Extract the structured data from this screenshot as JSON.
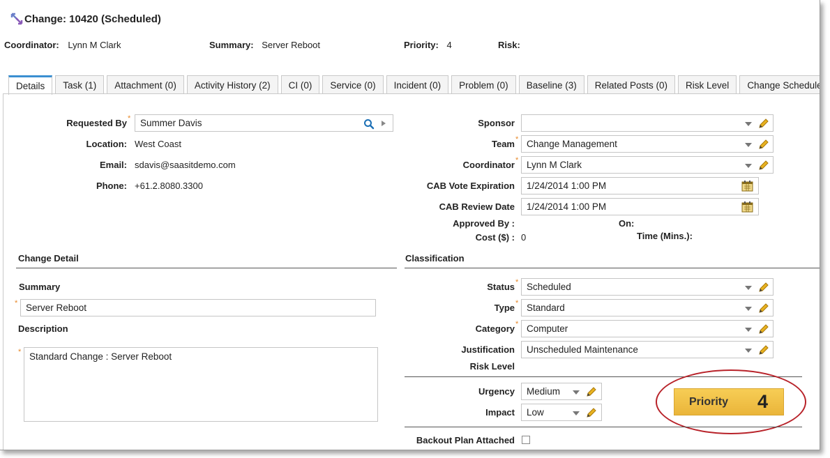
{
  "title": "Change: 10420 (Scheduled)",
  "header": {
    "coordinator_label": "Coordinator:",
    "coordinator_value": "Lynn M Clark",
    "summary_label": "Summary:",
    "summary_value": "Server Reboot",
    "priority_label": "Priority:",
    "priority_value": "4",
    "risk_label": "Risk:",
    "risk_value": ""
  },
  "tabs": [
    {
      "label": "Details"
    },
    {
      "label": "Task (1)"
    },
    {
      "label": "Attachment (0)"
    },
    {
      "label": "Activity History (2)"
    },
    {
      "label": "CI (0)"
    },
    {
      "label": "Service (0)"
    },
    {
      "label": "Incident (0)"
    },
    {
      "label": "Problem (0)"
    },
    {
      "label": "Baseline (3)"
    },
    {
      "label": "Related Posts (0)"
    },
    {
      "label": "Risk Level"
    },
    {
      "label": "Change Schedule"
    }
  ],
  "left": {
    "requested_by_label": "Requested By",
    "requested_by_value": "Summer Davis",
    "location_label": "Location:",
    "location_value": "West Coast",
    "email_label": "Email:",
    "email_value": "sdavis@saasitdemo.com",
    "phone_label": "Phone:",
    "phone_value": "+61.2.8080.3300"
  },
  "right": {
    "sponsor_label": "Sponsor",
    "sponsor_value": "",
    "team_label": "Team",
    "team_value": "Change Management",
    "coordinator_label": "Coordinator",
    "coordinator_value": "Lynn M Clark",
    "cab_vote_label": "CAB Vote Expiration",
    "cab_vote_value": "1/24/2014 1:00 PM",
    "cab_review_label": "CAB Review Date",
    "cab_review_value": "1/24/2014 1:00 PM",
    "approved_by_label": "Approved By :",
    "on_label": "On:",
    "cost_label": "Cost ($) :",
    "cost_value": "0",
    "time_label": "Time (Mins.):"
  },
  "change_detail": {
    "section_title": "Change Detail",
    "summary_label": "Summary",
    "summary_value": "Server Reboot",
    "description_label": "Description",
    "description_value": "Standard Change : Server Reboot"
  },
  "classification": {
    "section_title": "Classification",
    "status_label": "Status",
    "status_value": "Scheduled",
    "type_label": "Type",
    "type_value": "Standard",
    "category_label": "Category",
    "category_value": "Computer",
    "justification_label": "Justification",
    "justification_value": "Unscheduled Maintenance",
    "risk_level_label": "Risk Level",
    "urgency_label": "Urgency",
    "urgency_value": "Medium",
    "impact_label": "Impact",
    "impact_value": "Low",
    "priority_label": "Priority",
    "priority_value": "4",
    "backout_label": "Backout Plan Attached"
  },
  "colors": {
    "accent_tab": "#3b8fd1",
    "required_star": "#e8892b",
    "priority_fill": "#f2c04a",
    "annotation_ring": "#b8232a"
  }
}
